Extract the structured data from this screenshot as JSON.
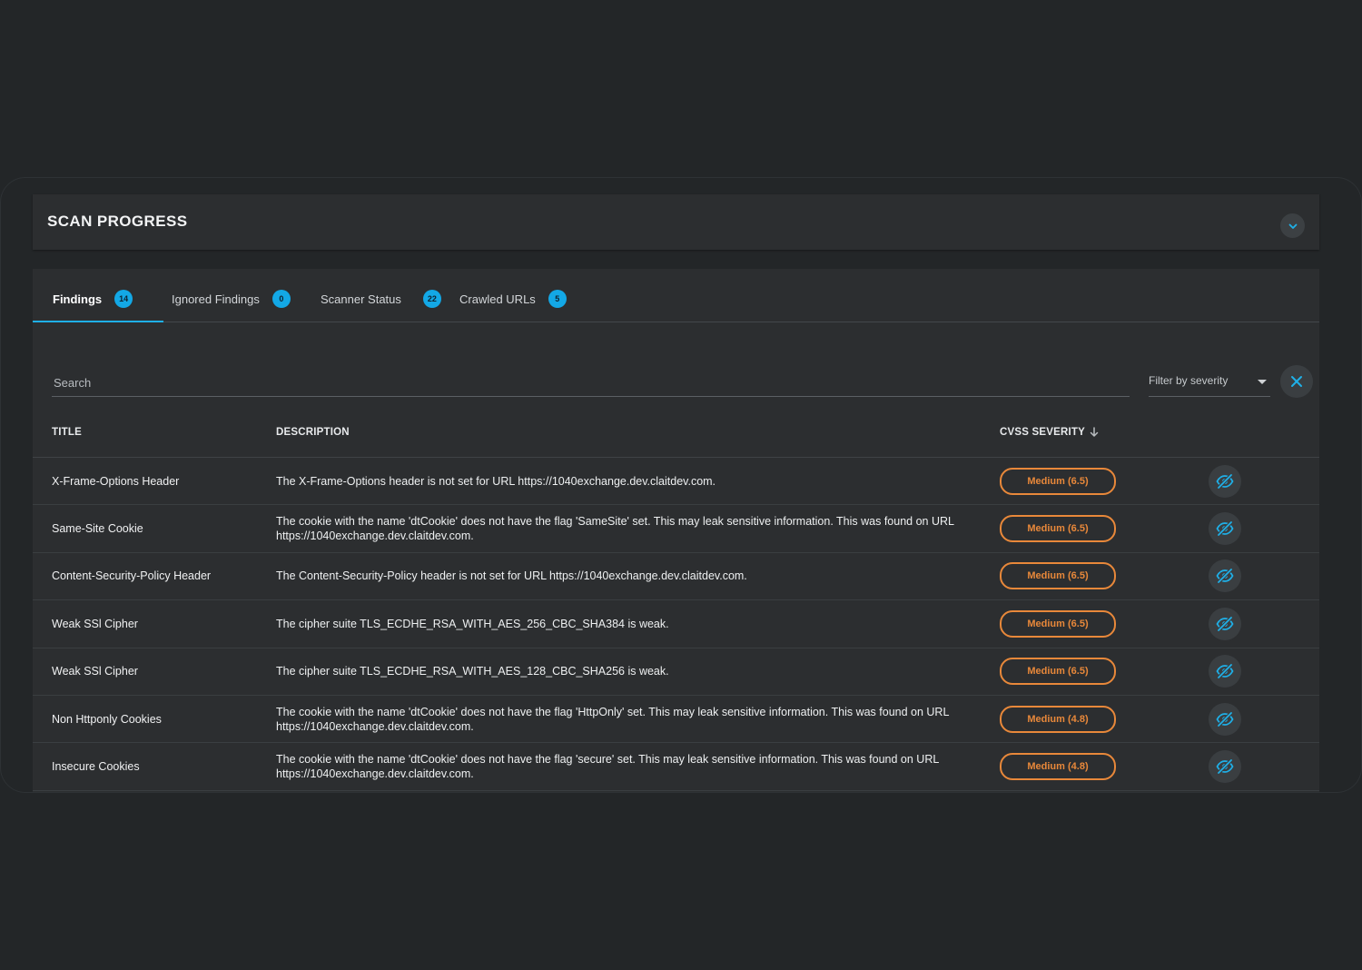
{
  "progress": {
    "title": "SCAN PROGRESS"
  },
  "tabs": [
    {
      "label": "Findings",
      "count": "14"
    },
    {
      "label": "Ignored Findings",
      "count": "0"
    },
    {
      "label": "Scanner Status",
      "count": "22"
    },
    {
      "label": "Crawled URLs",
      "count": "5"
    }
  ],
  "search": {
    "placeholder": "Search"
  },
  "filter": {
    "label": "Filter by severity"
  },
  "table": {
    "headers": {
      "title": "TITLE",
      "description": "DESCRIPTION",
      "severity": "CVSS SEVERITY"
    },
    "rows": [
      {
        "title": "X-Frame-Options Header",
        "description": "The X-Frame-Options header is not set for URL https://1040exchange.dev.claitdev.com.",
        "severity": "Medium (6.5)"
      },
      {
        "title": "Same-Site Cookie",
        "description": "The cookie with the name 'dtCookie' does not have the flag 'SameSite' set. This may leak sensitive information. This was found on URL https://1040exchange.dev.claitdev.com.",
        "severity": "Medium (6.5)"
      },
      {
        "title": "Content-Security-Policy Header",
        "description": "The Content-Security-Policy header is not set for URL https://1040exchange.dev.claitdev.com.",
        "severity": "Medium (6.5)"
      },
      {
        "title": "Weak SSl Cipher",
        "description": "The cipher suite TLS_ECDHE_RSA_WITH_AES_256_CBC_SHA384 is weak.",
        "severity": "Medium (6.5)"
      },
      {
        "title": "Weak SSl Cipher",
        "description": "The cipher suite TLS_ECDHE_RSA_WITH_AES_128_CBC_SHA256 is weak.",
        "severity": "Medium (6.5)"
      },
      {
        "title": "Non Httponly Cookies",
        "description": "The cookie with the name 'dtCookie' does not have the flag 'HttpOnly' set. This may leak sensitive information. This was found on URL https://1040exchange.dev.claitdev.com.",
        "severity": "Medium (4.8)"
      },
      {
        "title": "Insecure Cookies",
        "description": "The cookie with the name 'dtCookie' does not have the flag 'secure' set. This may leak sensitive information. This was found on URL https://1040exchange.dev.claitdev.com.",
        "severity": "Medium (4.8)"
      }
    ]
  },
  "icons": {
    "collapse": "chevron-down-icon",
    "clear": "close-icon",
    "filter_caret": "caret-down-icon",
    "sort": "arrow-down-icon",
    "ignore": "eye-off-icon"
  },
  "colors": {
    "accent": "#13a8e6",
    "severity_medium": "#e8883a",
    "background": "#232628",
    "card": "#2c2e30"
  }
}
